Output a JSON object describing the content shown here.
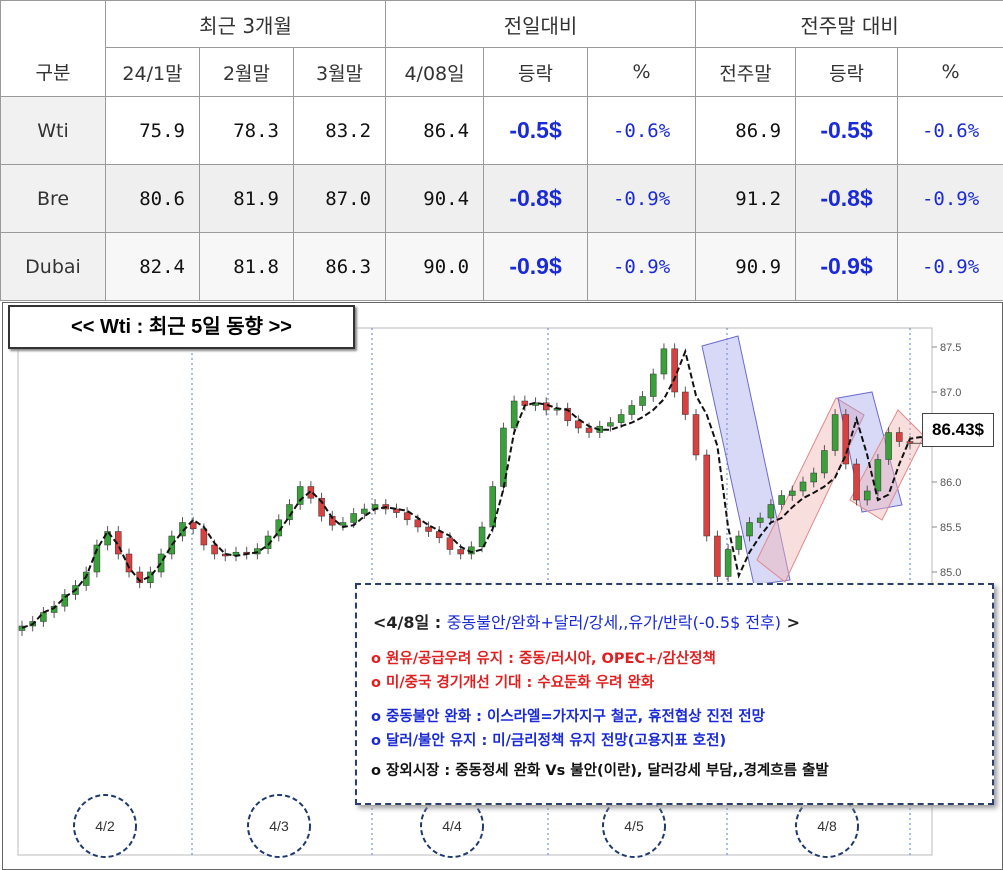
{
  "table": {
    "header": {
      "group_label": "구분",
      "recent3m": "최근 3개월",
      "prevday": "전일대비",
      "prevweek": "전주말 대비",
      "col_jan": "24/1말",
      "col_feb": "2월말",
      "col_mar": "3월말",
      "col_day": "4/08일",
      "col_chg": "등락",
      "col_pct": "%",
      "col_wk": "전주말",
      "col_chg2": "등락",
      "col_pct2": "%"
    },
    "rows": [
      {
        "name": "Wti",
        "jan": "75.9",
        "feb": "78.3",
        "mar": "83.2",
        "day": "86.4",
        "chg": "-0.5$",
        "pct": "-0.6%",
        "wk": "86.9",
        "chg2": "-0.5$",
        "pct2": "-0.6%"
      },
      {
        "name": "Bre",
        "jan": "80.6",
        "feb": "81.9",
        "mar": "87.0",
        "day": "90.4",
        "chg": "-0.8$",
        "pct": "-0.9%",
        "wk": "91.2",
        "chg2": "-0.8$",
        "pct2": "-0.9%"
      },
      {
        "name": "Dubai",
        "jan": "82.4",
        "feb": "81.8",
        "mar": "86.3",
        "day": "90.0",
        "chg": "-0.9$",
        "pct": "-0.9%",
        "wk": "90.9",
        "chg2": "-0.9$",
        "pct2": "-0.9%"
      }
    ]
  },
  "chart_title": "<< Wti : 최근 5일 동향 >>",
  "price_tag": "86.43$",
  "note": {
    "title_prefix": "<4/8일 : ",
    "title_main": "중동불안/완화+달러/강세,,유가/반락(-0.5$ 전후)",
    "title_suffix": " >",
    "lines": [
      "o 원유/공급우려 유지 : 중동/러시아, OPEC+/감산정책",
      "o 미/중국 경기개선 기대 : 수요둔화 우려 완화",
      "o 중동불안 완화 : 이스라엘=가자지구 철군, 휴전협상 진전 전망",
      "o 달러/불안 유지 : 미/금리정책 유지 전망(고용지표 호전)",
      "o 장외시장 : 중동정세 완화 Vs 불안(이란), 달러강세 부담,,경계흐름 출발"
    ],
    "line_colors": [
      "#e02020",
      "#e02020",
      "#1a2ad6",
      "#1a2ad6",
      "#111111"
    ]
  },
  "colors": {
    "up": "#3aa03a",
    "down": "#d94040",
    "accent": "#1a2ad6"
  },
  "chart_data": {
    "type": "line",
    "title": "<< Wti : 최근 5일 동향 >>",
    "xlabel": "",
    "ylabel": "",
    "ylim": [
      84.8,
      87.6
    ],
    "y_ticks": [
      85.0,
      85.5,
      86.0,
      86.5,
      87.0,
      87.5
    ],
    "day_labels": [
      "4/2",
      "4/3",
      "4/4",
      "4/5",
      "4/8"
    ],
    "series": [
      {
        "values": [
          84.38,
          84.42,
          84.55,
          84.6,
          84.72,
          84.8,
          84.95,
          85.25,
          85.45,
          85.3,
          85.05,
          84.9,
          84.95,
          85.1,
          85.3,
          85.45,
          85.58,
          85.5,
          85.32,
          85.2,
          85.18,
          85.2,
          85.22,
          85.3,
          85.45,
          85.62,
          85.8,
          85.9,
          85.78,
          85.6,
          85.5,
          85.52,
          85.62,
          85.7,
          85.72,
          85.7,
          85.68,
          85.6,
          85.52,
          85.46,
          85.4,
          85.28,
          85.22,
          85.25,
          85.48,
          85.92,
          86.55,
          86.85,
          86.88,
          86.86,
          86.82,
          86.8,
          86.7,
          86.62,
          86.58,
          86.58,
          86.62,
          86.66,
          86.72,
          86.8,
          86.92,
          87.15,
          87.45,
          86.96,
          86.75,
          86.4,
          85.5,
          84.96,
          85.22,
          85.4,
          85.55,
          85.6,
          85.72,
          85.82,
          85.88,
          85.95,
          86.05,
          86.3,
          86.7,
          86.3,
          85.8,
          85.86,
          86.2,
          86.48,
          86.5,
          86.43
        ],
        "candles": [
          {
            "o": 84.35,
            "c": 84.4
          },
          {
            "o": 84.4,
            "c": 84.45
          },
          {
            "o": 84.45,
            "c": 84.55
          },
          {
            "o": 84.55,
            "c": 84.62
          },
          {
            "o": 84.62,
            "c": 84.75
          },
          {
            "o": 84.75,
            "c": 84.85
          },
          {
            "o": 84.85,
            "c": 85.0
          },
          {
            "o": 85.0,
            "c": 85.3
          },
          {
            "o": 85.3,
            "c": 85.45
          },
          {
            "o": 85.45,
            "c": 85.2
          },
          {
            "o": 85.2,
            "c": 85.0
          },
          {
            "o": 85.0,
            "c": 84.88
          },
          {
            "o": 84.88,
            "c": 85.0
          },
          {
            "o": 85.0,
            "c": 85.2
          },
          {
            "o": 85.2,
            "c": 85.4
          },
          {
            "o": 85.4,
            "c": 85.55
          },
          {
            "o": 85.55,
            "c": 85.48
          },
          {
            "o": 85.48,
            "c": 85.3
          },
          {
            "o": 85.3,
            "c": 85.2
          },
          {
            "o": 85.2,
            "c": 85.18
          },
          {
            "o": 85.18,
            "c": 85.22
          },
          {
            "o": 85.22,
            "c": 85.2
          },
          {
            "o": 85.2,
            "c": 85.26
          },
          {
            "o": 85.26,
            "c": 85.4
          },
          {
            "o": 85.4,
            "c": 85.58
          },
          {
            "o": 85.58,
            "c": 85.75
          },
          {
            "o": 85.75,
            "c": 85.95
          },
          {
            "o": 85.95,
            "c": 85.82
          },
          {
            "o": 85.82,
            "c": 85.62
          },
          {
            "o": 85.62,
            "c": 85.52
          },
          {
            "o": 85.52,
            "c": 85.55
          },
          {
            "o": 85.55,
            "c": 85.65
          },
          {
            "o": 85.65,
            "c": 85.7
          },
          {
            "o": 85.7,
            "c": 85.75
          },
          {
            "o": 85.75,
            "c": 85.7
          },
          {
            "o": 85.7,
            "c": 85.66
          },
          {
            "o": 85.66,
            "c": 85.58
          },
          {
            "o": 85.58,
            "c": 85.5
          },
          {
            "o": 85.5,
            "c": 85.45
          },
          {
            "o": 85.45,
            "c": 85.38
          },
          {
            "o": 85.38,
            "c": 85.25
          },
          {
            "o": 85.25,
            "c": 85.2
          },
          {
            "o": 85.2,
            "c": 85.28
          },
          {
            "o": 85.28,
            "c": 85.5
          },
          {
            "o": 85.5,
            "c": 85.95
          },
          {
            "o": 85.95,
            "c": 86.6
          },
          {
            "o": 86.6,
            "c": 86.9
          },
          {
            "o": 86.9,
            "c": 86.85
          },
          {
            "o": 86.85,
            "c": 86.88
          },
          {
            "o": 86.88,
            "c": 86.8
          },
          {
            "o": 86.8,
            "c": 86.82
          },
          {
            "o": 86.82,
            "c": 86.68
          },
          {
            "o": 86.68,
            "c": 86.6
          },
          {
            "o": 86.6,
            "c": 86.55
          },
          {
            "o": 86.55,
            "c": 86.62
          },
          {
            "o": 86.62,
            "c": 86.66
          },
          {
            "o": 86.66,
            "c": 86.75
          },
          {
            "o": 86.75,
            "c": 86.85
          },
          {
            "o": 86.85,
            "c": 86.95
          },
          {
            "o": 86.95,
            "c": 87.2
          },
          {
            "o": 87.2,
            "c": 87.48
          },
          {
            "o": 87.48,
            "c": 87.0
          },
          {
            "o": 87.0,
            "c": 86.75
          },
          {
            "o": 86.75,
            "c": 86.3
          },
          {
            "o": 86.3,
            "c": 85.4
          },
          {
            "o": 85.4,
            "c": 84.95
          },
          {
            "o": 84.95,
            "c": 85.25
          },
          {
            "o": 85.25,
            "c": 85.4
          },
          {
            "o": 85.4,
            "c": 85.55
          },
          {
            "o": 85.55,
            "c": 85.6
          },
          {
            "o": 85.6,
            "c": 85.75
          },
          {
            "o": 85.75,
            "c": 85.85
          },
          {
            "o": 85.85,
            "c": 85.9
          },
          {
            "o": 85.9,
            "c": 86.0
          },
          {
            "o": 86.0,
            "c": 86.1
          },
          {
            "o": 86.1,
            "c": 86.35
          },
          {
            "o": 86.35,
            "c": 86.75
          },
          {
            "o": 86.75,
            "c": 86.2
          },
          {
            "o": 86.2,
            "c": 85.8
          },
          {
            "o": 85.8,
            "c": 85.9
          },
          {
            "o": 85.9,
            "c": 86.25
          },
          {
            "o": 86.25,
            "c": 86.55
          },
          {
            "o": 86.55,
            "c": 86.45
          },
          {
            "o": 86.45,
            "c": 86.43
          }
        ]
      }
    ],
    "grid": true
  }
}
